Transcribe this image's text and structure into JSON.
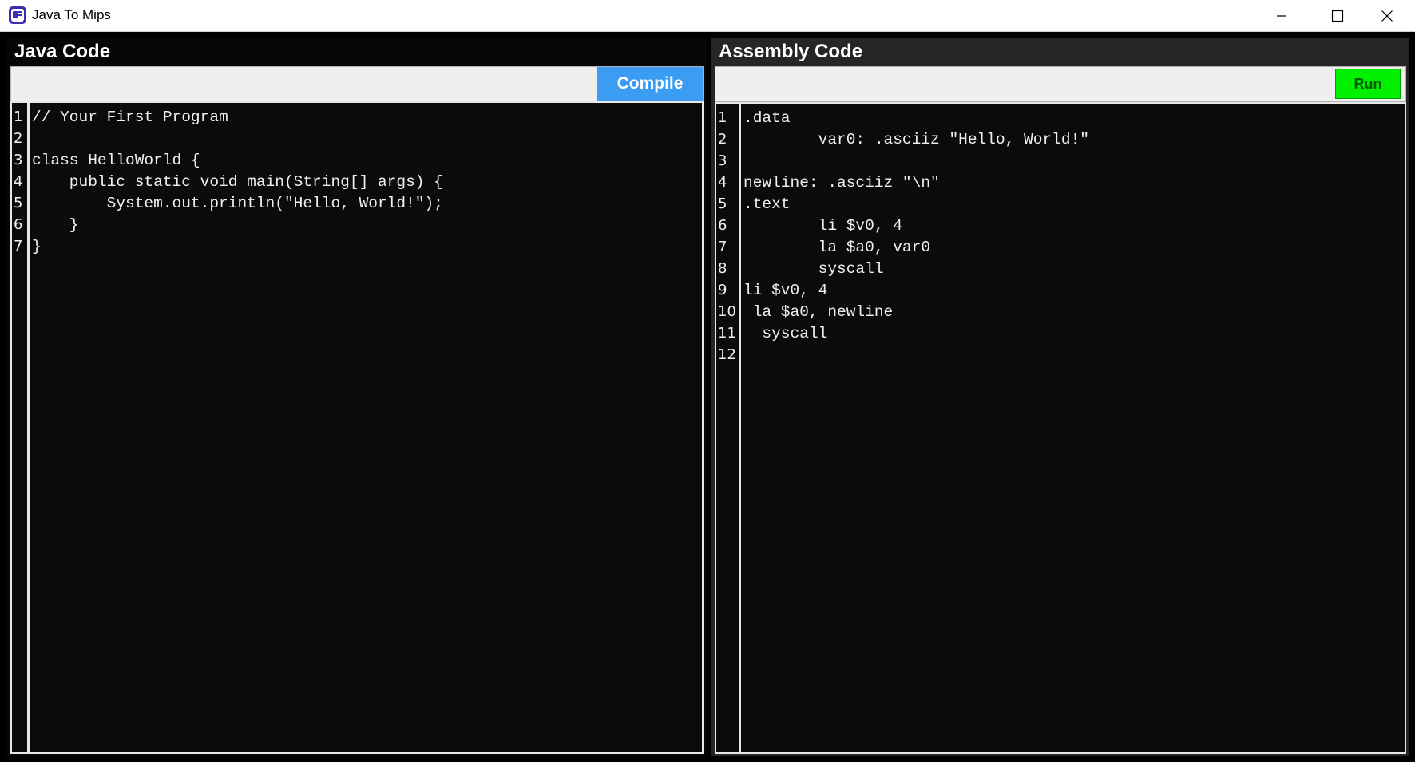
{
  "window": {
    "title": "Java To Mips"
  },
  "java_panel": {
    "title": "Java Code",
    "compile_label": "Compile",
    "lines": [
      "// Your First Program",
      "",
      "class HelloWorld {",
      "    public static void main(String[] args) {",
      "        System.out.println(\"Hello, World!\");",
      "    }",
      "}"
    ],
    "line_numbers": [
      "1",
      "2",
      "3",
      "4",
      "5",
      "6",
      "7"
    ]
  },
  "assembly_panel": {
    "title": "Assembly Code",
    "run_label": "Run",
    "lines": [
      ".data",
      "        var0: .asciiz \"Hello, World!\"",
      "",
      "newline: .asciiz \"\\n\"",
      ".text",
      "        li $v0, 4",
      "        la $a0, var0",
      "        syscall",
      "li $v0, 4",
      " la $a0, newline",
      "  syscall",
      ""
    ],
    "line_numbers": [
      "1",
      "2",
      "3",
      "4",
      "5",
      "6",
      "7",
      "8",
      "9",
      "10",
      "11",
      "12"
    ]
  },
  "colors": {
    "compile_button": "#3a9cf3",
    "run_button": "#00f000",
    "editor_background": "#0b0b0b",
    "text": "#f0f0f0"
  }
}
